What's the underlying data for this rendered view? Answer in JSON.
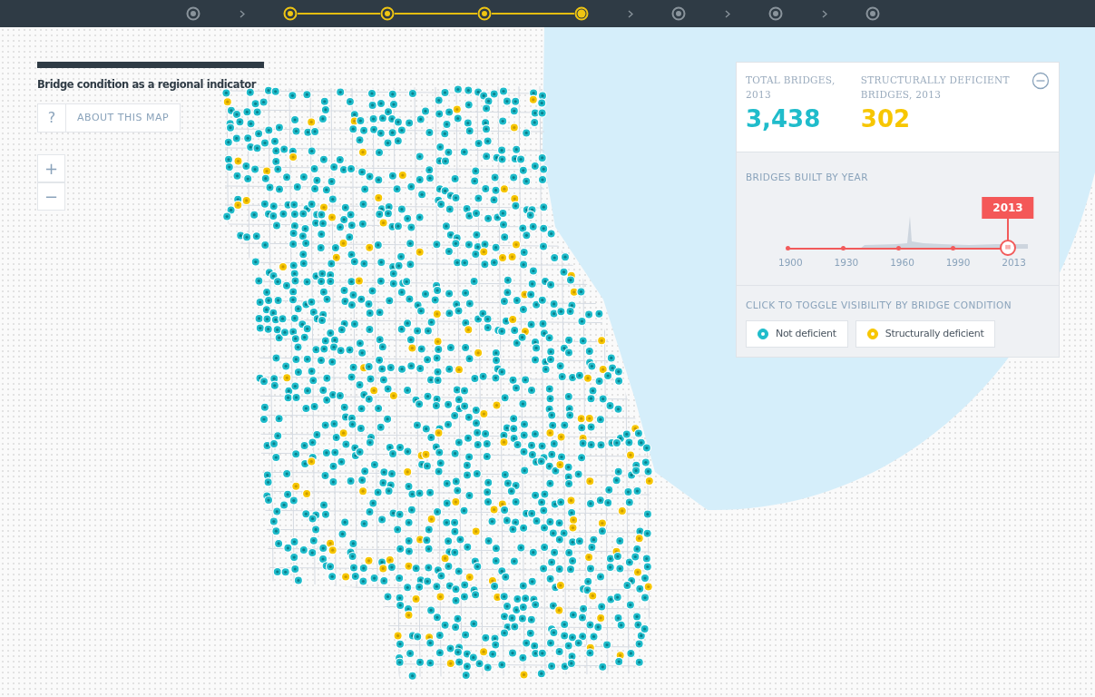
{
  "progress_steps": [
    {
      "active": false,
      "current": false
    },
    {
      "active": true,
      "current": false
    },
    {
      "active": true,
      "current": false
    },
    {
      "active": true,
      "current": false
    },
    {
      "active": true,
      "current": true
    },
    {
      "active": false,
      "current": false
    },
    {
      "active": false,
      "current": false
    },
    {
      "active": false,
      "current": false
    }
  ],
  "title": "Bridge condition as a regional indicator",
  "about_button": {
    "icon_text": "?",
    "label": "ABOUT THIS MAP"
  },
  "zoom_controls": [
    "+",
    "−"
  ],
  "stats": [
    {
      "label": "TOTAL BRIDGES, 2013",
      "value": "3,438",
      "color": "#1fbccb"
    },
    {
      "label": "STRUCTURALLY DEFICIENT BRIDGES, 2013",
      "value": "302",
      "color": "#f7c600"
    }
  ],
  "year_slider": {
    "heading": "BRIDGES BUILT BY YEAR",
    "tooltip": "2013",
    "level": 1,
    "ticks": [
      "1900",
      "1930",
      "1960",
      "1990",
      "2013"
    ]
  },
  "toggle": {
    "heading": "CLICK TO TOGGLE VISIBILITY BY BRIDGE CONDITION",
    "items": [
      {
        "label": "Not deficient",
        "color": "#1fbccb",
        "on": true
      },
      {
        "label": "Structurally deficient",
        "color": "#f7c600",
        "on": true
      }
    ]
  }
}
